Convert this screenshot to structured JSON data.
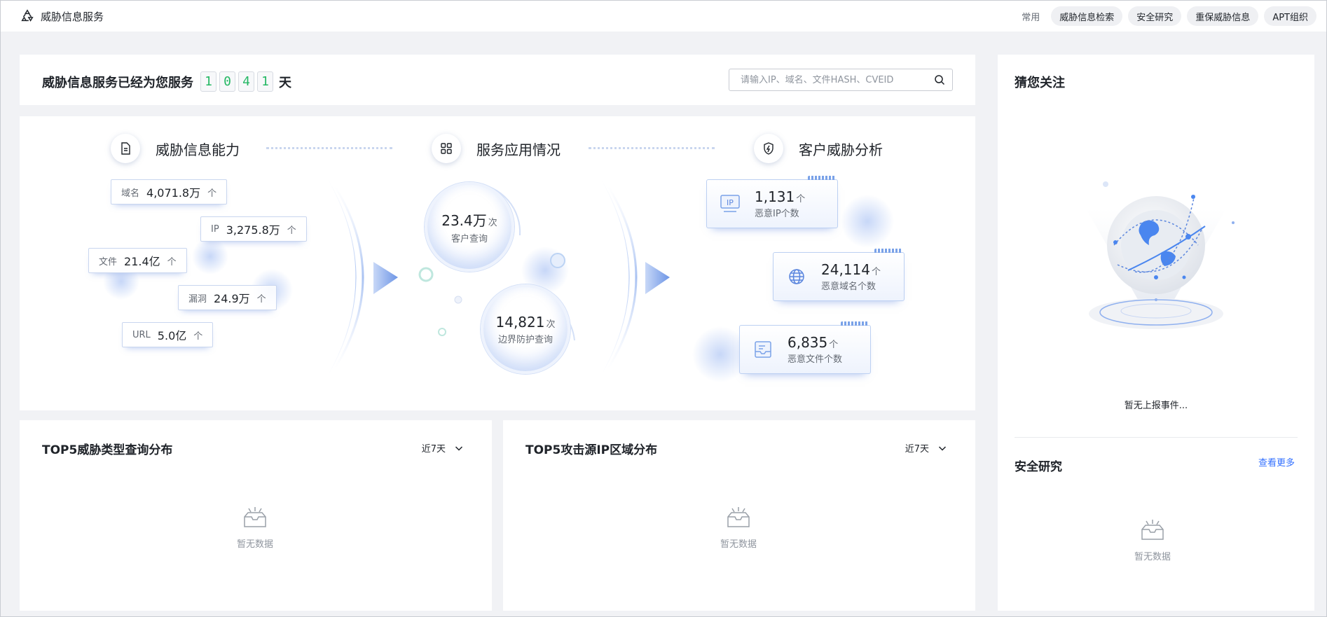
{
  "header": {
    "app_title": "威胁信息服务",
    "quick_label": "常用",
    "quick_links": [
      "威胁信息检索",
      "安全研究",
      "重保威胁信息",
      "APT组织"
    ]
  },
  "service": {
    "prefix": "威胁信息服务已经为您服务",
    "digits": [
      "1",
      "0",
      "4",
      "1"
    ],
    "suffix": "天",
    "search_placeholder": "请输入IP、域名、文件HASH、CVEID"
  },
  "capability": {
    "title": "威胁信息能力",
    "tags": [
      {
        "label": "域名",
        "value": "4,071.8万",
        "unit": "个"
      },
      {
        "label": "IP",
        "value": "3,275.8万",
        "unit": "个"
      },
      {
        "label": "文件",
        "value": "21.4亿",
        "unit": "个"
      },
      {
        "label": "漏洞",
        "value": "24.9万",
        "unit": "个"
      },
      {
        "label": "URL",
        "value": "5.0亿",
        "unit": "个"
      }
    ]
  },
  "usage": {
    "title": "服务应用情况",
    "bubbles": [
      {
        "value": "23.4万",
        "unit": "次",
        "label": "客户查询"
      },
      {
        "value": "14,821",
        "unit": "次",
        "label": "边界防护查询"
      }
    ]
  },
  "analysis": {
    "title": "客户威胁分析",
    "stats": [
      {
        "value": "1,131",
        "unit": "个",
        "label": "恶意IP个数",
        "icon_text": "IP"
      },
      {
        "value": "24,114",
        "unit": "个",
        "label": "恶意域名个数"
      },
      {
        "value": "6,835",
        "unit": "个",
        "label": "恶意文件个数"
      }
    ]
  },
  "top5_threat": {
    "title": "TOP5威胁类型查询分布",
    "range": "近7天",
    "empty": "暂无数据"
  },
  "top5_source": {
    "title": "TOP5攻击源IP区域分布",
    "range": "近7天",
    "empty": "暂无数据"
  },
  "side": {
    "title": "猜您关注",
    "empty_events": "暂无上报事件...",
    "research_title": "安全研究",
    "more": "查看更多",
    "research_empty": "暂无数据"
  },
  "colors": {
    "accent": "#3370ff",
    "digit": "#25b864",
    "page_bg": "#f1f2f5"
  }
}
